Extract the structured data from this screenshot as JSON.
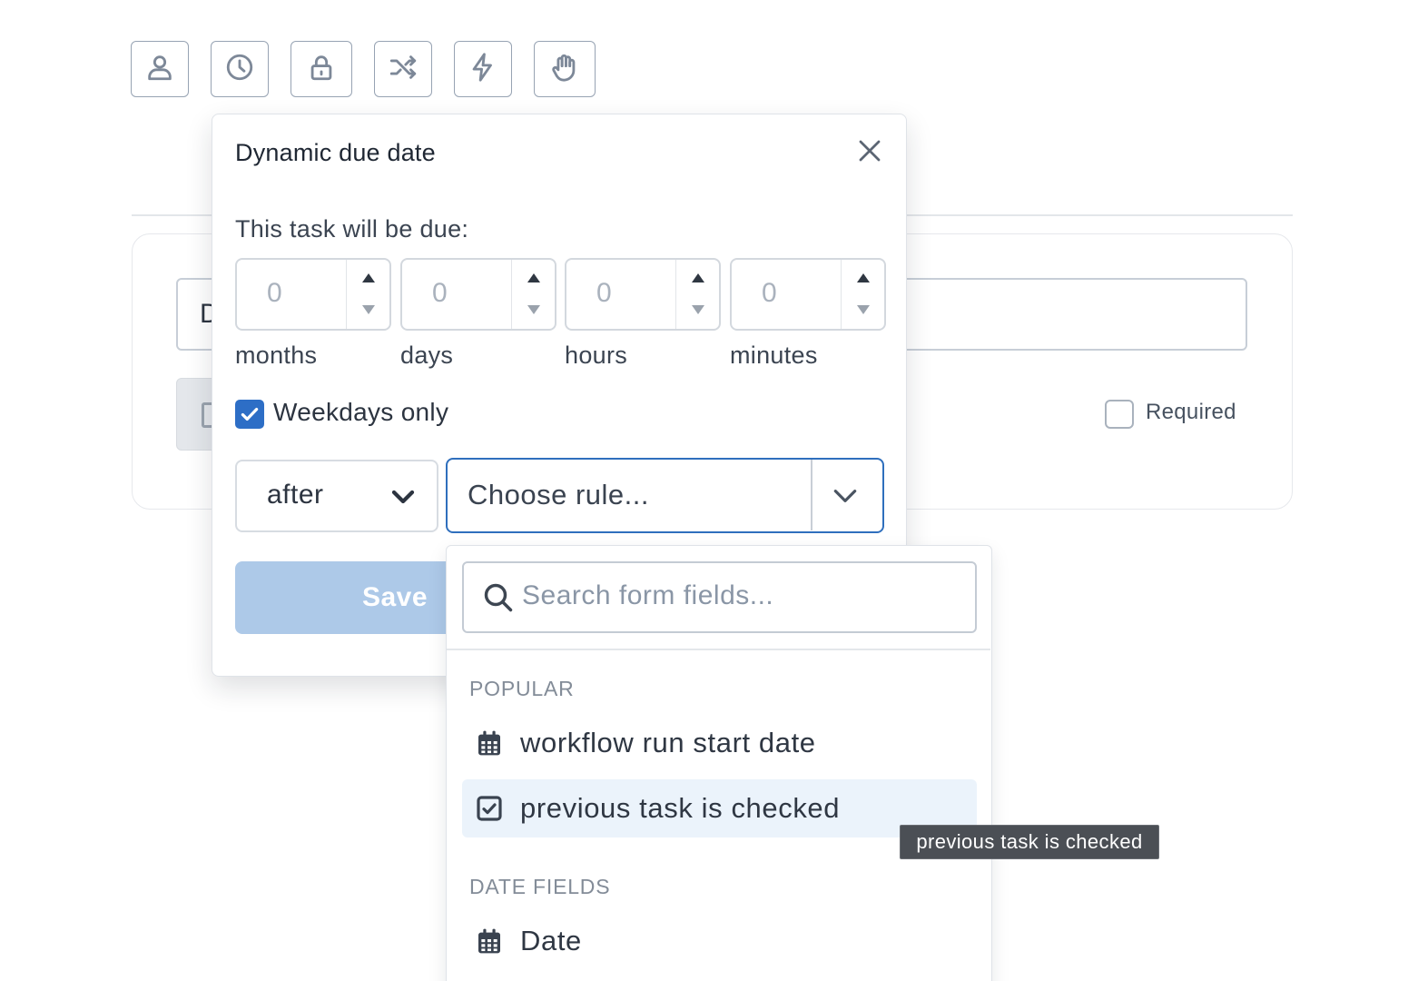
{
  "toolbar": {
    "icons": [
      "user-icon",
      "clock-icon",
      "lock-icon",
      "shuffle-icon",
      "lightning-icon",
      "hand-icon"
    ]
  },
  "background": {
    "title_input_visible_text": "D",
    "required_label": "Required"
  },
  "modal": {
    "title": "Dynamic due date",
    "due_label": "This task will be due:",
    "fields": [
      {
        "placeholder": "0",
        "unit": "months"
      },
      {
        "placeholder": "0",
        "unit": "days"
      },
      {
        "placeholder": "0",
        "unit": "hours"
      },
      {
        "placeholder": "0",
        "unit": "minutes"
      }
    ],
    "weekdays_label": "Weekdays only",
    "weekdays_checked": true,
    "relation_value": "after",
    "rule_placeholder": "Choose rule...",
    "save_label": "Save"
  },
  "dropdown": {
    "search_placeholder": "Search form fields...",
    "sections": [
      {
        "title": "POPULAR",
        "items": [
          {
            "label": "workflow run start date",
            "icon": "calendar-icon"
          },
          {
            "label": "previous task is checked",
            "icon": "checkbox-icon"
          }
        ]
      },
      {
        "title": "DATE FIELDS",
        "items": [
          {
            "label": "Date",
            "icon": "calendar-icon"
          }
        ]
      }
    ]
  },
  "tooltip": "previous task is checked",
  "colors": {
    "accent": "#2d6ec6",
    "save_disabled": "#adc9e8",
    "active_item": "#ebf3fb",
    "tooltip_bg": "#4b4f55"
  }
}
